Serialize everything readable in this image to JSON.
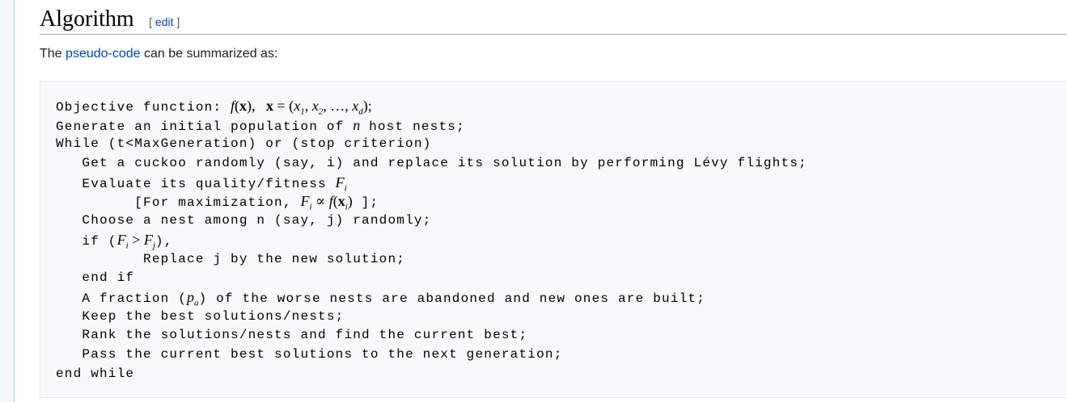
{
  "heading": {
    "title": "Algorithm",
    "edit_open": "[ ",
    "edit_label": "edit",
    "edit_close": " ]"
  },
  "intro": {
    "before": "The ",
    "link": "pseudo-code",
    "after": " can be summarized as:"
  },
  "colors": {
    "link": "#0645ad",
    "code_bg": "#f8f9fa"
  },
  "code_lines": [
    {
      "indent": 0,
      "segments": [
        {
          "t": "Objective function: "
        },
        {
          "m": "f"
        },
        {
          "r": "("
        },
        {
          "b": "x"
        },
        {
          "r": "),   "
        },
        {
          "b": "x"
        },
        {
          "r": " = ("
        },
        {
          "m": "x",
          "sub": "1"
        },
        {
          "r": ", "
        },
        {
          "m": "x",
          "sub": "2"
        },
        {
          "r": ", …, "
        },
        {
          "m": "x",
          "sub": "d"
        },
        {
          "r": ");"
        }
      ]
    },
    {
      "indent": 0,
      "segments": [
        {
          "t": "Generate an initial population of "
        },
        {
          "m": "n"
        },
        {
          "t": " host nests;"
        }
      ]
    },
    {
      "indent": 0,
      "segments": [
        {
          "t": "While (t<MaxGeneration) or (stop criterion)"
        }
      ]
    },
    {
      "indent": 3,
      "segments": [
        {
          "t": "Get a cuckoo randomly (say, i) and replace its solution by performing Lévy flights;"
        }
      ]
    },
    {
      "indent": 3,
      "segments": [
        {
          "t": "Evaluate its quality/fitness "
        },
        {
          "m": "F",
          "sub": "i"
        }
      ]
    },
    {
      "indent": 9,
      "segments": [
        {
          "t": "[For maximization, "
        },
        {
          "m": "F",
          "sub": "i"
        },
        {
          "r": " ∝ "
        },
        {
          "m": "f"
        },
        {
          "r": "("
        },
        {
          "b": "x",
          "sub": "i"
        },
        {
          "r": ")"
        },
        {
          "t": " ];"
        }
      ]
    },
    {
      "indent": 3,
      "segments": [
        {
          "t": "Choose a nest among n (say, j) randomly;"
        }
      ]
    },
    {
      "indent": 3,
      "segments": [
        {
          "t": "if ("
        },
        {
          "m": "F",
          "sub": "i"
        },
        {
          "r": " > "
        },
        {
          "m": "F",
          "sub": "j"
        },
        {
          "t": "),"
        }
      ]
    },
    {
      "indent": 10,
      "segments": [
        {
          "t": "Replace j by the new solution;"
        }
      ]
    },
    {
      "indent": 3,
      "segments": [
        {
          "t": "end if"
        }
      ]
    },
    {
      "indent": 3,
      "segments": [
        {
          "t": "A fraction ("
        },
        {
          "m": "p",
          "sub": "a"
        },
        {
          "t": ") of the worse nests are abandoned and new ones are built;"
        }
      ]
    },
    {
      "indent": 3,
      "segments": [
        {
          "t": "Keep the best solutions/nests;"
        }
      ]
    },
    {
      "indent": 3,
      "segments": [
        {
          "t": "Rank the solutions/nests and find the current best;"
        }
      ]
    },
    {
      "indent": 3,
      "segments": [
        {
          "t": "Pass the current best solutions to the next generation;"
        }
      ]
    },
    {
      "indent": 0,
      "segments": [
        {
          "t": "end while"
        }
      ]
    }
  ]
}
